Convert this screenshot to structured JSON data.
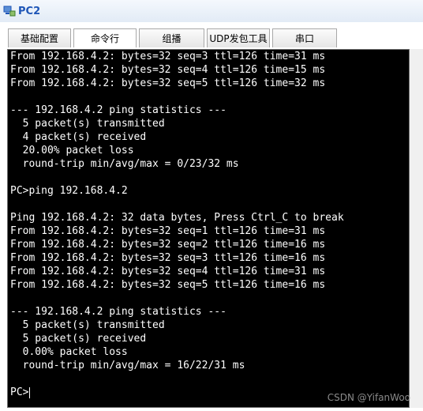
{
  "window": {
    "title": "PC2",
    "icon": "computer-icon"
  },
  "tabs": [
    {
      "label": "基础配置",
      "active": false
    },
    {
      "label": "命令行",
      "active": true
    },
    {
      "label": "组播",
      "active": false
    },
    {
      "label": "UDP发包工具",
      "active": false
    },
    {
      "label": "串口",
      "active": false
    }
  ],
  "terminal": {
    "lines": [
      "From 192.168.4.2: bytes=32 seq=3 ttl=126 time=31 ms",
      "From 192.168.4.2: bytes=32 seq=4 ttl=126 time=15 ms",
      "From 192.168.4.2: bytes=32 seq=5 ttl=126 time=32 ms",
      "",
      "--- 192.168.4.2 ping statistics ---",
      "  5 packet(s) transmitted",
      "  4 packet(s) received",
      "  20.00% packet loss",
      "  round-trip min/avg/max = 0/23/32 ms",
      "",
      "PC>ping 192.168.4.2",
      "",
      "Ping 192.168.4.2: 32 data bytes, Press Ctrl_C to break",
      "From 192.168.4.2: bytes=32 seq=1 ttl=126 time=31 ms",
      "From 192.168.4.2: bytes=32 seq=2 ttl=126 time=16 ms",
      "From 192.168.4.2: bytes=32 seq=3 ttl=126 time=16 ms",
      "From 192.168.4.2: bytes=32 seq=4 ttl=126 time=31 ms",
      "From 192.168.4.2: bytes=32 seq=5 ttl=126 time=16 ms",
      "",
      "--- 192.168.4.2 ping statistics ---",
      "  5 packet(s) transmitted",
      "  5 packet(s) received",
      "  0.00% packet loss",
      "  round-trip min/avg/max = 16/22/31 ms",
      ""
    ],
    "prompt": "PC>"
  },
  "watermark": "CSDN @YifanWoo",
  "colors": {
    "title": "#1f56b7",
    "terminal_bg": "#000000",
    "terminal_fg": "#ffffff"
  }
}
